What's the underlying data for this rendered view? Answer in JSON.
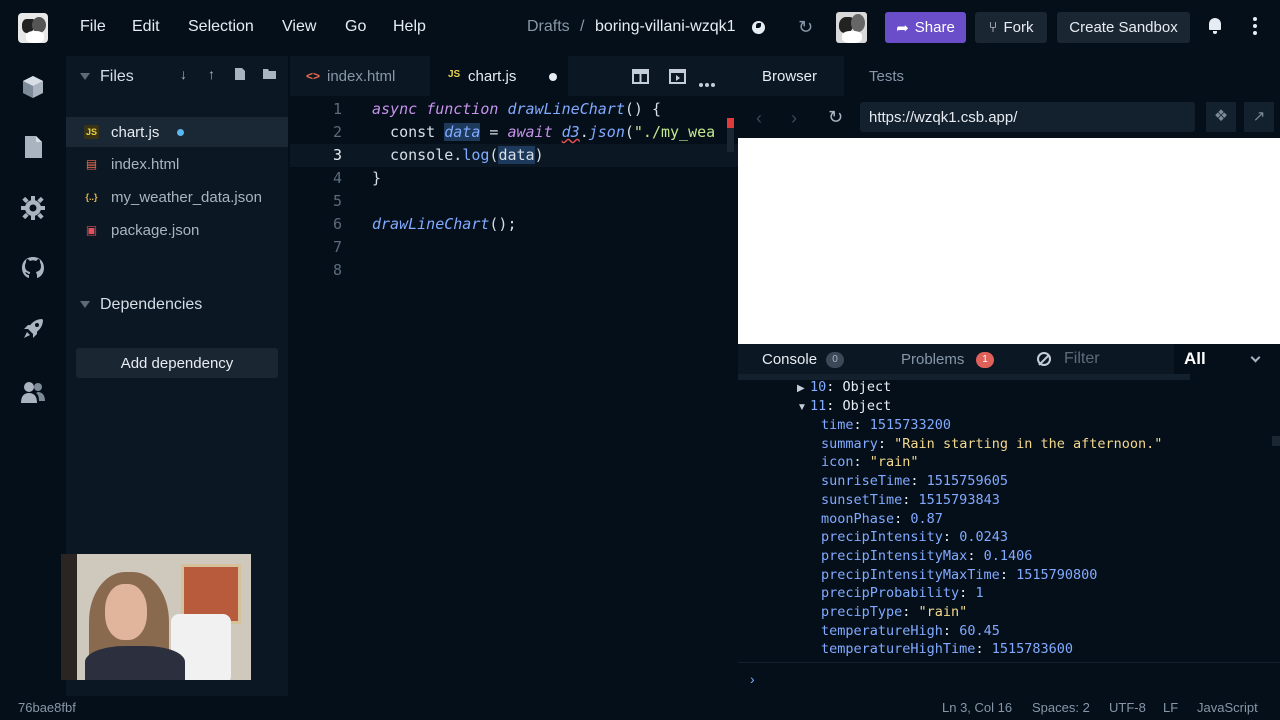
{
  "menu": {
    "items": [
      "File",
      "Edit",
      "Selection",
      "View",
      "Go",
      "Help"
    ]
  },
  "breadcrumb": {
    "folder": "Drafts",
    "separator": "/",
    "sandbox_name": "boring-villani-wzqk1"
  },
  "header": {
    "share_label": "Share",
    "fork_label": "Fork",
    "create_label": "Create Sandbox"
  },
  "sidebar": {
    "files_title": "Files",
    "files": [
      {
        "name": "chart.js",
        "icon": "js-file-icon",
        "active": true,
        "modified": true
      },
      {
        "name": "index.html",
        "icon": "html-file-icon",
        "active": false
      },
      {
        "name": "my_weather_data.json",
        "icon": "json-file-icon",
        "active": false
      },
      {
        "name": "package.json",
        "icon": "npm-file-icon",
        "active": false
      }
    ],
    "dependencies_title": "Dependencies",
    "add_dependency_label": "Add dependency"
  },
  "editor": {
    "tabs": [
      {
        "label": "index.html",
        "icon": "html-icon"
      },
      {
        "label": "chart.js",
        "icon": "js-icon",
        "dirty": true
      }
    ],
    "line_numbers": [
      "1",
      "2",
      "3",
      "4",
      "5",
      "6",
      "7",
      "8"
    ],
    "current_line": 3
  },
  "browser": {
    "tabs": [
      "Browser",
      "Tests"
    ],
    "url": "https://wzqk1.csb.app/"
  },
  "console": {
    "tab_console": "Console",
    "console_count": "0",
    "tab_problems": "Problems",
    "problems_count": "1",
    "filter_placeholder": "Filter",
    "level": "All",
    "collapsed_entry": {
      "index": "10",
      "label": "Object"
    },
    "expanded_entry": {
      "index": "11",
      "label": "Object"
    },
    "fields": [
      {
        "key": "time",
        "value": "1515733200",
        "type": "number"
      },
      {
        "key": "summary",
        "value": "\"Rain starting in the afternoon.\"",
        "type": "string"
      },
      {
        "key": "icon",
        "value": "\"rain\"",
        "type": "string"
      },
      {
        "key": "sunriseTime",
        "value": "1515759605",
        "type": "number"
      },
      {
        "key": "sunsetTime",
        "value": "1515793843",
        "type": "number"
      },
      {
        "key": "moonPhase",
        "value": "0.87",
        "type": "number"
      },
      {
        "key": "precipIntensity",
        "value": "0.0243",
        "type": "number"
      },
      {
        "key": "precipIntensityMax",
        "value": "0.1406",
        "type": "number"
      },
      {
        "key": "precipIntensityMaxTime",
        "value": "1515790800",
        "type": "number"
      },
      {
        "key": "precipProbability",
        "value": "1",
        "type": "number"
      },
      {
        "key": "precipType",
        "value": "\"rain\"",
        "type": "string"
      },
      {
        "key": "temperatureHigh",
        "value": "60.45",
        "type": "number"
      },
      {
        "key": "temperatureHighTime",
        "value": "1515783600",
        "type": "number"
      }
    ]
  },
  "status": {
    "commit": "76bae8fbf",
    "position": "Ln 3, Col 16",
    "spaces": "Spaces: 2",
    "encoding": "UTF-8",
    "eol": "LF",
    "language": "JavaScript"
  },
  "colors": {
    "accent": "#6a4ec9",
    "background": "#040f1a",
    "panel": "#0b1824"
  }
}
